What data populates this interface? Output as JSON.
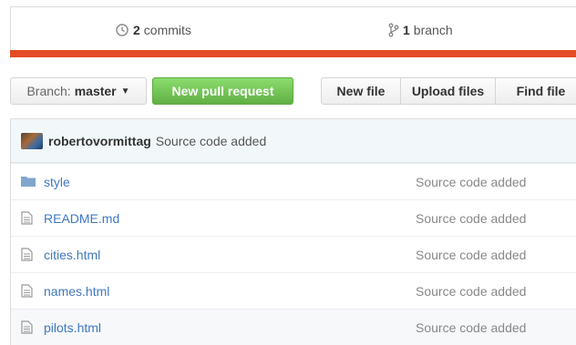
{
  "stats": {
    "commits_count": "2",
    "commits_label": "commits",
    "branch_count": "1",
    "branch_label": "branch"
  },
  "toolbar": {
    "branch_prefix": "Branch:",
    "branch_name": "master",
    "new_pull_request": "New pull request",
    "new_file": "New file",
    "upload_files": "Upload files",
    "find_file": "Find file"
  },
  "latest_commit": {
    "author": "robertovormittag",
    "message": "Source code added"
  },
  "files": [
    {
      "name": "style",
      "type": "folder",
      "message": "Source code added"
    },
    {
      "name": "README.md",
      "type": "file",
      "message": "Source code added"
    },
    {
      "name": "cities.html",
      "type": "file",
      "message": "Source code added"
    },
    {
      "name": "names.html",
      "type": "file",
      "message": "Source code added"
    },
    {
      "name": "pilots.html",
      "type": "file",
      "message": "Source code added"
    }
  ],
  "colors": {
    "language_bar": "#e34c26",
    "primary_button": "#6cc644",
    "link": "#4078c0"
  }
}
